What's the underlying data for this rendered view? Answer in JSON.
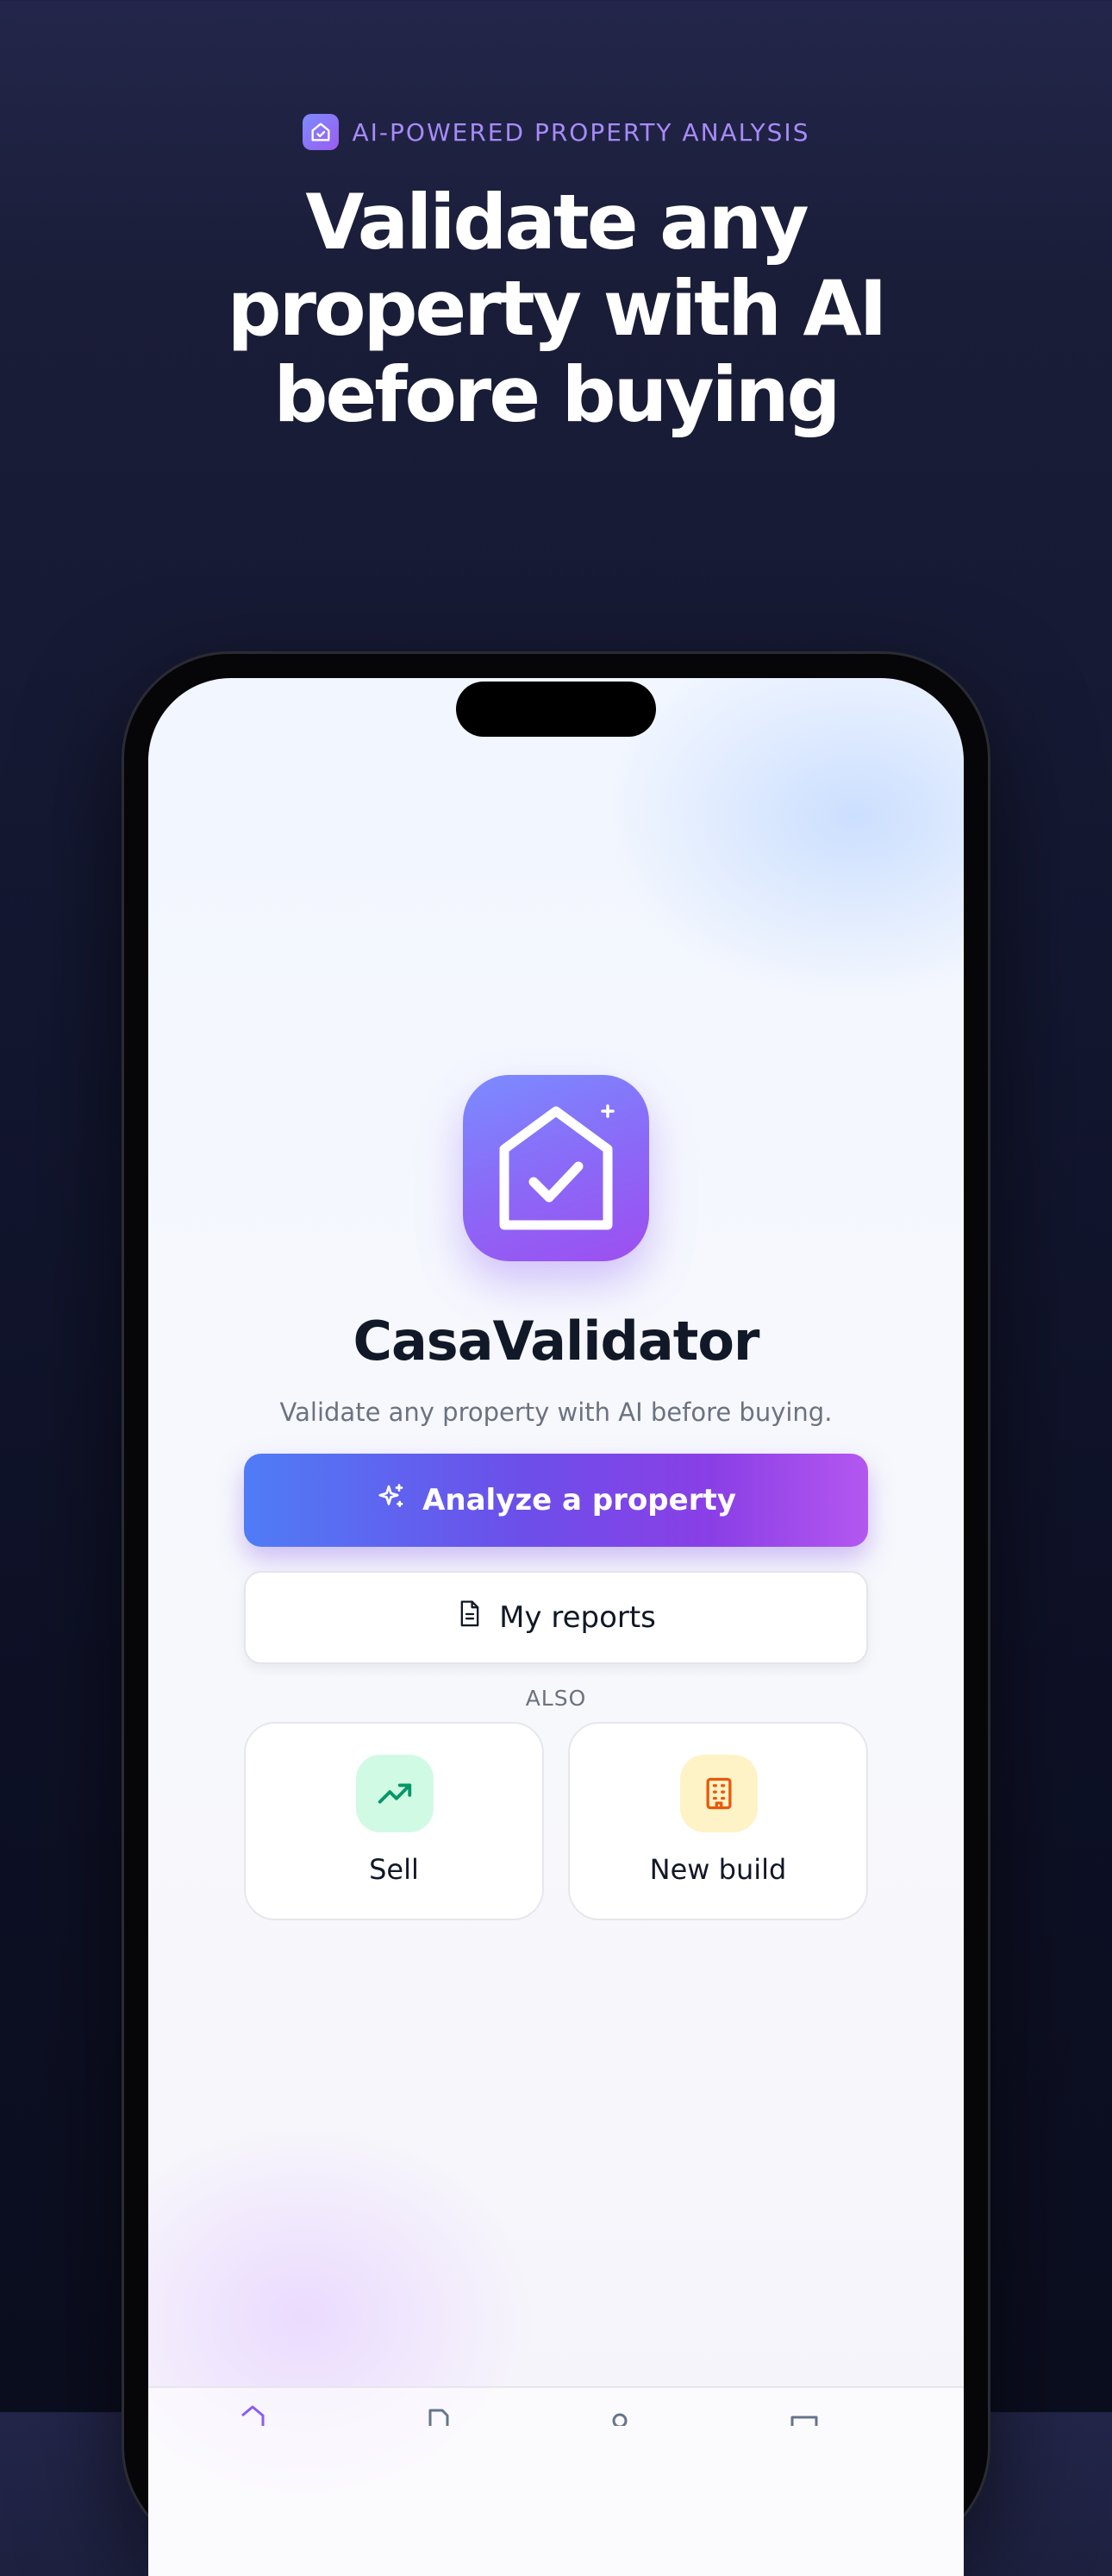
{
  "hero": {
    "eyebrow": "AI-POWERED PROPERTY ANALYSIS",
    "headline_lines": [
      "Validate any",
      "property with AI",
      "before buying"
    ]
  },
  "app": {
    "name": "CasaValidator",
    "tagline": "Validate any property with AI before buying.",
    "primary_button": "Analyze a property",
    "secondary_button": "My reports",
    "also_label": "ALSO",
    "cards": [
      {
        "label": "Sell",
        "icon": "trending-up-icon"
      },
      {
        "label": "New build",
        "icon": "building-icon"
      }
    ]
  },
  "tabbar": {
    "items": [
      {
        "icon": "home-icon"
      },
      {
        "icon": "document-icon"
      },
      {
        "icon": "user-icon"
      },
      {
        "icon": "inbox-icon"
      }
    ]
  },
  "colors": {
    "accent_blue": "#4f7cf6",
    "accent_purple": "#8a3fe6",
    "eyebrow": "#a78bfa",
    "sell_green": "#059669",
    "newbuild_orange": "#ea580c"
  }
}
